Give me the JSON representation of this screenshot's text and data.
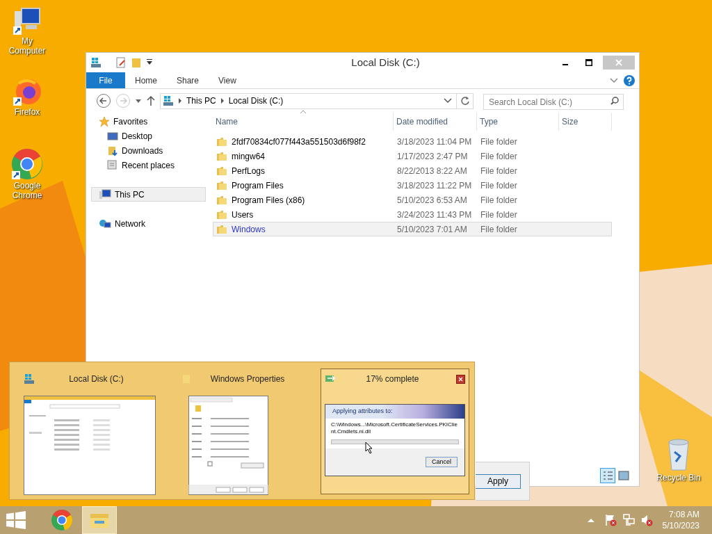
{
  "desktop_icons": [
    {
      "label": "My Computer",
      "kind": "computer"
    },
    {
      "label": "Firefox",
      "kind": "firefox"
    },
    {
      "label": "Google Chrome",
      "kind": "chrome"
    }
  ],
  "recycle_bin": {
    "label": "Recycle Bin"
  },
  "explorer": {
    "title": "Local Disk (C:)",
    "ribbon_tabs": [
      {
        "label": "File",
        "selected": true
      },
      {
        "label": "Home",
        "selected": false
      },
      {
        "label": "Share",
        "selected": false
      },
      {
        "label": "View",
        "selected": false
      }
    ],
    "breadcrumb": [
      "This PC",
      "Local Disk (C:)"
    ],
    "search": {
      "placeholder": "Search Local Disk (C:)"
    },
    "nav": [
      {
        "label": "Favorites",
        "kind": "favorites",
        "selected": false,
        "children": [
          {
            "label": "Desktop",
            "kind": "desktop",
            "selected": false
          },
          {
            "label": "Downloads",
            "kind": "downloads",
            "selected": false
          },
          {
            "label": "Recent places",
            "kind": "recent",
            "selected": false
          }
        ]
      },
      {
        "label": "This PC",
        "kind": "pc",
        "selected": true
      },
      {
        "label": "Network",
        "kind": "network",
        "selected": false
      }
    ],
    "columns": [
      "Name",
      "Date modified",
      "Type",
      "Size"
    ],
    "rows": [
      {
        "name": "2fdf70834cf077f443a551503d6f98f2",
        "date": "3/18/2023 11:04 PM",
        "type": "File folder",
        "selected": false
      },
      {
        "name": "mingw64",
        "date": "1/17/2023 2:47 PM",
        "type": "File folder",
        "selected": false
      },
      {
        "name": "PerfLogs",
        "date": "8/22/2013 8:22 AM",
        "type": "File folder",
        "selected": false
      },
      {
        "name": "Program Files",
        "date": "3/18/2023 11:22 PM",
        "type": "File folder",
        "selected": false
      },
      {
        "name": "Program Files (x86)",
        "date": "5/10/2023 6:53 AM",
        "type": "File folder",
        "selected": false
      },
      {
        "name": "Users",
        "date": "3/24/2023 11:43 PM",
        "type": "File folder",
        "selected": false
      },
      {
        "name": "Windows",
        "date": "5/10/2023 7:01 AM",
        "type": "File folder",
        "selected": true
      }
    ]
  },
  "background_dialog": {
    "button": "Apply"
  },
  "thumbnails": [
    {
      "title": "Local Disk (C:)",
      "kind": "explorer",
      "selected": false
    },
    {
      "title": "Windows Properties",
      "kind": "properties",
      "selected": false
    },
    {
      "title": "17% complete",
      "kind": "progress",
      "selected": true,
      "heading": "Applying attributes to:",
      "path": "C:\\Windows...\\Microsoft.CertificateServices.PKIClient.Cmdlets.ni.dll",
      "button": "Cancel",
      "level": 0
    }
  ],
  "taskbar": {
    "apps": [
      {
        "kind": "chrome",
        "active": false
      },
      {
        "kind": "explorer",
        "active": true
      }
    ],
    "time": "7:08 AM",
    "date": "5/10/2023"
  }
}
